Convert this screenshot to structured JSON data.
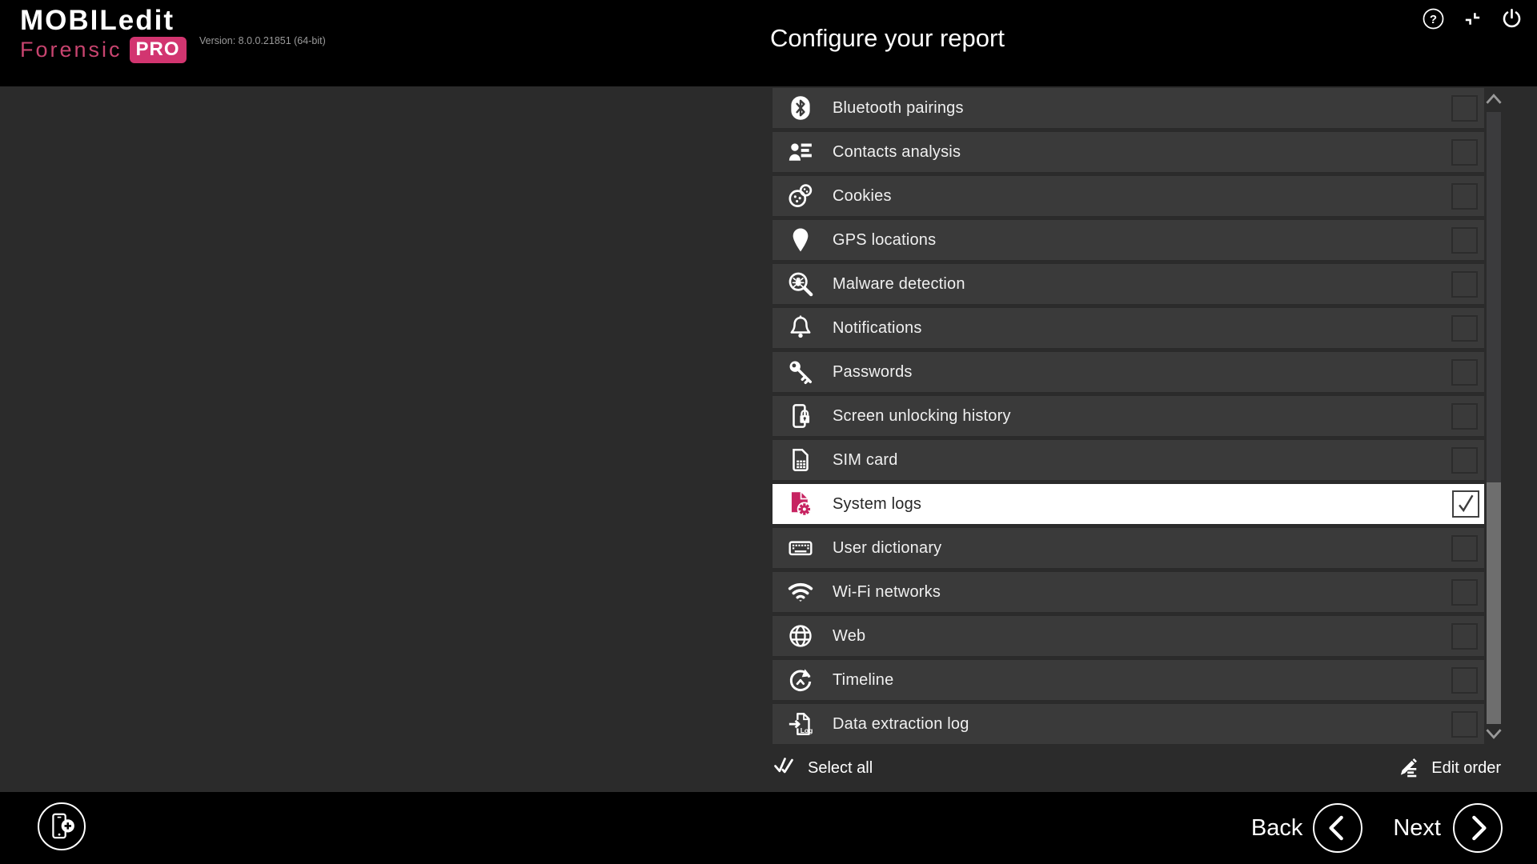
{
  "header": {
    "logo": {
      "line1": "MOBILedit",
      "line2": "Forensic",
      "badge": "PRO"
    },
    "version": "Version: 8.0.0.21851 (64-bit)",
    "title": "Configure your report"
  },
  "report_list": {
    "items": [
      {
        "label": "Bluetooth pairings",
        "icon": "bluetooth",
        "checked": false,
        "selected": false
      },
      {
        "label": "Contacts analysis",
        "icon": "contacts",
        "checked": false,
        "selected": false
      },
      {
        "label": "Cookies",
        "icon": "cookies",
        "checked": false,
        "selected": false
      },
      {
        "label": "GPS locations",
        "icon": "gps",
        "checked": false,
        "selected": false
      },
      {
        "label": "Malware detection",
        "icon": "malware",
        "checked": false,
        "selected": false
      },
      {
        "label": "Notifications",
        "icon": "notifications",
        "checked": false,
        "selected": false
      },
      {
        "label": "Passwords",
        "icon": "passwords",
        "checked": false,
        "selected": false
      },
      {
        "label": "Screen unlocking history",
        "icon": "screen-unlock",
        "checked": false,
        "selected": false
      },
      {
        "label": "SIM card",
        "icon": "sim-card",
        "checked": false,
        "selected": false
      },
      {
        "label": "System logs",
        "icon": "system-logs",
        "checked": true,
        "selected": true
      },
      {
        "label": "User dictionary",
        "icon": "user-dictionary",
        "checked": false,
        "selected": false
      },
      {
        "label": "Wi-Fi networks",
        "icon": "wifi",
        "checked": false,
        "selected": false
      },
      {
        "label": "Web",
        "icon": "web",
        "checked": false,
        "selected": false
      },
      {
        "label": "Timeline",
        "icon": "timeline",
        "checked": false,
        "selected": false
      },
      {
        "label": "Data extraction log",
        "icon": "data-extraction-log",
        "checked": false,
        "selected": false
      }
    ],
    "select_all_label": "Select all",
    "edit_order_label": "Edit order"
  },
  "footer": {
    "back_label": "Back",
    "next_label": "Next"
  },
  "colors": {
    "accent_pink": "#c72361",
    "badge_pink": "#d23570",
    "bar_bg": "#000000",
    "page_bg": "#2b2b2b",
    "row_bg": "#3a3a3a",
    "selected_row_bg": "#ffffff",
    "row_text": "#f0f0f0",
    "scroll_thumb": "#6e6e6e"
  }
}
